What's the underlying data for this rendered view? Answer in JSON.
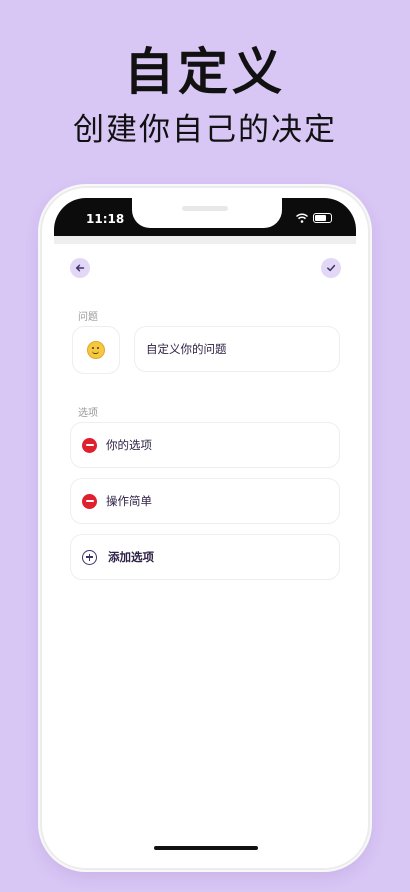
{
  "promo": {
    "title": "自定义",
    "subtitle": "创建你自己的决定"
  },
  "status_bar": {
    "time": "11:18",
    "icons": [
      "wifi-icon",
      "battery-icon"
    ]
  },
  "toolbar": {
    "back_icon": "arrow-left-icon",
    "confirm_icon": "checkmark-icon"
  },
  "question": {
    "section_label": "问题",
    "emoji": "slightly-smiling-face",
    "text": "自定义你的问题"
  },
  "options": {
    "section_label": "选项",
    "items": [
      {
        "label": "你的选项",
        "icon": "remove-icon"
      },
      {
        "label": "操作简单",
        "icon": "remove-icon"
      }
    ],
    "add_label": "添加选项"
  },
  "colors": {
    "background": "#d8c6f5",
    "accent": "#e3d7f8",
    "remove": "#e0202c",
    "text": "#2e2246"
  }
}
